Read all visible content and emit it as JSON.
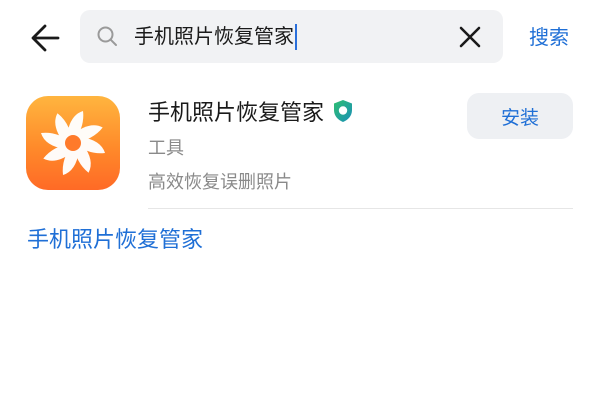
{
  "header": {
    "back_icon": "arrow-left-icon",
    "search": {
      "query": "手机照片恢复管家",
      "search_icon": "search-icon",
      "clear_icon": "close-icon"
    },
    "submit_label": "搜索",
    "accent_color": "#1f6fd6"
  },
  "result": {
    "app_name": "手机照片恢复管家",
    "verified_icon": "shield-verified-icon",
    "category": "工具",
    "description": "高效恢复误删照片",
    "install_label": "安装",
    "icon_colors": [
      "#ffb53f",
      "#ff6a26"
    ]
  },
  "suggestions": [
    {
      "label": "手机照片恢复管家"
    }
  ]
}
